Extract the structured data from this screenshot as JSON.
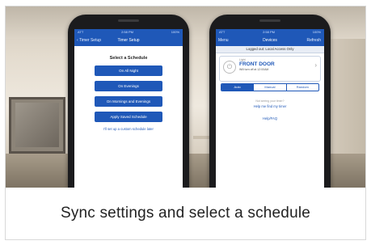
{
  "caption": "Sync settings and select a schedule",
  "phone_left": {
    "status_left": "ATT",
    "status_time": "2:58 PM",
    "status_right": "100%",
    "back_label": "Timer Setup",
    "title": "Timer Setup",
    "heading": "Select a Schedule",
    "schedule_options": [
      "On All Night",
      "On Evenings",
      "On Mornings and Evenings",
      "Apply Saved Schedule"
    ],
    "custom_link": "I'll set up a custom schedule later"
  },
  "phone_right": {
    "status_left": "ATT",
    "status_time": "2:58 PM",
    "status_right": "100%",
    "menu_label": "Menu",
    "title": "Devices",
    "refresh_label": "Refresh",
    "logged_status": "Logged out: Local Access Only",
    "device": {
      "type_label": "Light",
      "name": "FRONT DOOR",
      "state_text": "Will turn off at 12:00AM"
    },
    "modes": [
      "Auto",
      "Manual",
      "Random"
    ],
    "question": "Not seeing your timer?",
    "help_link": "Help me find my timer",
    "faq_link": "Help/FAQ"
  },
  "colors": {
    "accent": "#1f58b8"
  }
}
